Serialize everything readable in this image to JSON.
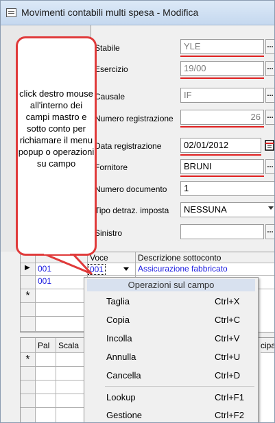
{
  "window": {
    "title": "Movimenti contabili multi spesa - Modifica"
  },
  "callout": {
    "text": "click destro mouse all'interno dei campi mastro e sotto conto per richiamare il menu popup o operazioni su campo"
  },
  "form": {
    "stabile": {
      "label": "Stabile",
      "value": "YLE"
    },
    "esercizio": {
      "label": "Esercizio",
      "value": "19/00"
    },
    "causale": {
      "label": "Causale",
      "value": "IF"
    },
    "numero_registrazione": {
      "label": "Numero registrazione",
      "value": "26"
    },
    "data_registrazione": {
      "label": "Data registrazione",
      "value": "02/01/2012"
    },
    "fornitore": {
      "label": "Fornitore",
      "value": "BRUNI"
    },
    "numero_documento": {
      "label": "Numero documento",
      "value": "1"
    },
    "tipo_detraz": {
      "label": "Tipo detraz. imposta",
      "value": "NESSUNA"
    },
    "sinistro": {
      "label": "Sinistro",
      "value": ""
    },
    "lookup_glyph": "..."
  },
  "grid1": {
    "headers": [
      "Voce",
      "Descrizione sottoconto"
    ],
    "rows": [
      {
        "mastro": "001",
        "voce": "001",
        "descrizione": "Assicurazione fabbricato"
      },
      {
        "mastro": "001",
        "voce": "",
        "descrizione": ""
      }
    ],
    "new_row_marker": "*",
    "current_row_marker": "▶"
  },
  "grid2": {
    "headers": [
      "Pal",
      "Scala",
      "cipar"
    ],
    "new_row_marker": "*"
  },
  "context_menu": {
    "title": "Operazioni sul campo",
    "items": [
      {
        "label": "Taglia",
        "shortcut": "Ctrl+X"
      },
      {
        "label": "Copia",
        "shortcut": "Ctrl+C"
      },
      {
        "label": "Incolla",
        "shortcut": "Ctrl+V"
      },
      {
        "label": "Annulla",
        "shortcut": "Ctrl+U"
      },
      {
        "label": "Cancella",
        "shortcut": "Ctrl+D"
      },
      {
        "label": "Lookup",
        "shortcut": "Ctrl+F1"
      },
      {
        "label": "Gestione",
        "shortcut": "Ctrl+F2"
      }
    ]
  },
  "colors": {
    "accent_red": "#e02020",
    "link_blue": "#1a1ae0",
    "menu_header": "#d8e1ef"
  }
}
